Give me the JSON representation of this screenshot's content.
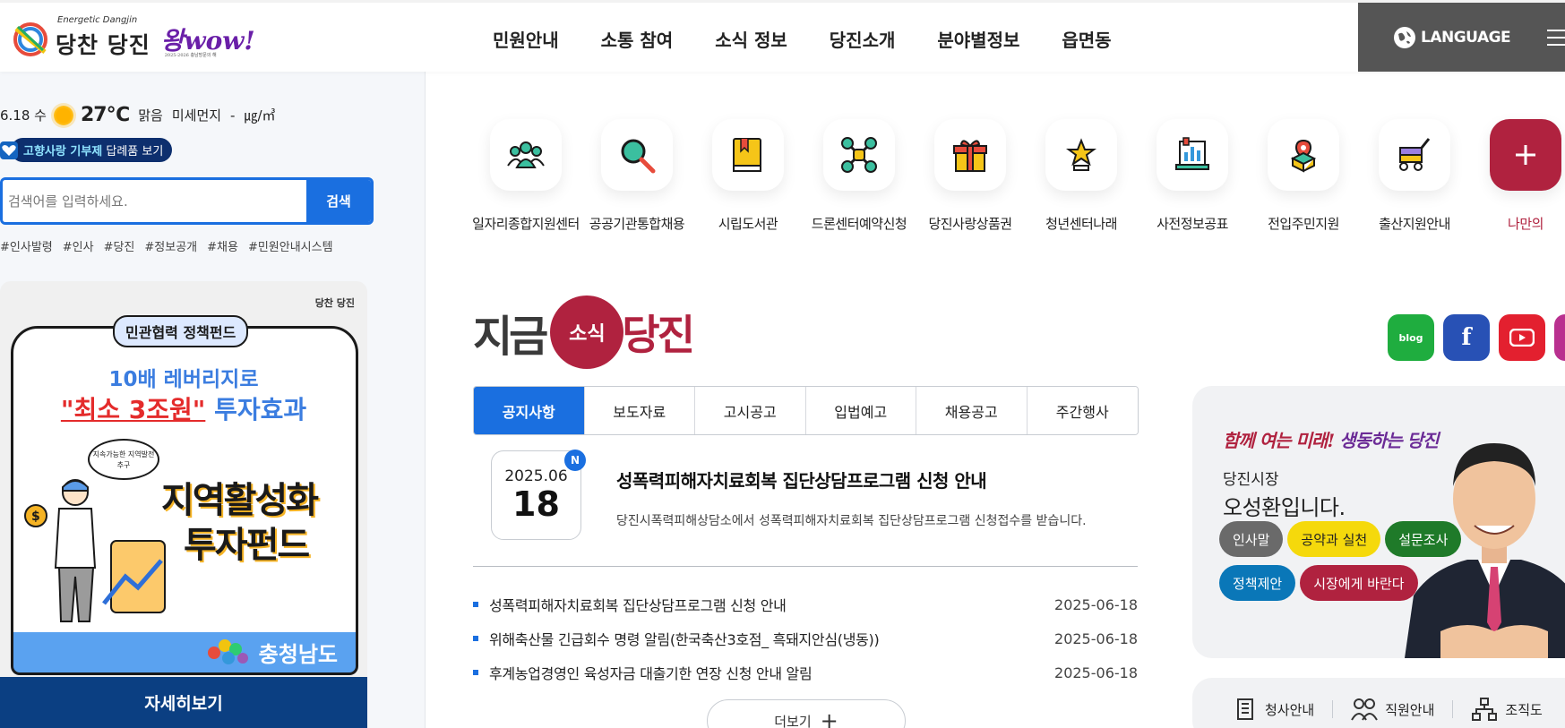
{
  "header": {
    "logo_tagline": "Energetic Dangjin",
    "logo_text": "당찬 당진",
    "wow_text": "왕wow!",
    "wow_sub": "2025-2026 충남방문의 해",
    "nav": [
      "민원안내",
      "소통 참여",
      "소식 정보",
      "당진소개",
      "분야별정보",
      "읍면동"
    ],
    "language_label": "LANGUAGE"
  },
  "weather": {
    "date": "6.18 수",
    "temperature": "27℃",
    "condition": "맑음",
    "dust_label": "미세먼지",
    "dust_value": "-",
    "dust_unit": "㎍/㎥"
  },
  "donation": {
    "highlight": "고향사랑 기부제",
    "rest": " 답례품 보기"
  },
  "search": {
    "placeholder": "검색어를 입력하세요.",
    "button": "검색"
  },
  "tags": [
    "#인사발령",
    "#인사",
    "#당진",
    "#정보공개",
    "#채용",
    "#민원안내시스템"
  ],
  "banner": {
    "logo_text": "당찬 당진",
    "tag": "민관협력 정책펀드",
    "line1": "10배 레버리지로",
    "line2_red": "\"최소 3조원\"",
    "line2_rest": " 투자효과",
    "bubble": "지속가능한 지역발전 추구",
    "big1": "지역활성화",
    "big2": "투자펀드",
    "province": "충청남도",
    "detail_button": "자세히보기"
  },
  "quick_links": [
    {
      "label": "일자리종합지원센터",
      "icon": "people-icon"
    },
    {
      "label": "공공기관통합채용",
      "icon": "search-icon"
    },
    {
      "label": "시립도서관",
      "icon": "book-icon"
    },
    {
      "label": "드론센터예약신청",
      "icon": "drone-icon"
    },
    {
      "label": "당진사랑상품권",
      "icon": "gift-icon"
    },
    {
      "label": "청년센터나래",
      "icon": "star-trophy-icon"
    },
    {
      "label": "사전정보공표",
      "icon": "chart-board-icon"
    },
    {
      "label": "전입주민지원",
      "icon": "location-box-icon"
    },
    {
      "label": "출산지원안내",
      "icon": "stroller-icon"
    },
    {
      "label": "나만의",
      "icon": "plus-icon"
    }
  ],
  "news": {
    "title_now": "지금",
    "title_circle": "소식",
    "title_dj": "당진",
    "tabs": [
      "공지사항",
      "보도자료",
      "고시공고",
      "입법예고",
      "채용공고",
      "주간행사"
    ],
    "featured": {
      "year_month": "2025.06",
      "day": "18",
      "badge": "N",
      "title": "성폭력피해자치료회복 집단상담프로그램 신청 안내",
      "desc": "당진시폭력피해상담소에서 성폭력피해자치료회복 집단상담프로그램 신청접수를 받습니다."
    },
    "items": [
      {
        "text": "성폭력피해자치료회복 집단상담프로그램 신청 안내",
        "date": "2025-06-18"
      },
      {
        "text": "위해축산물 긴급회수 명령 알림(한국축산3호점_ 흑돼지안심(냉동))",
        "date": "2025-06-18"
      },
      {
        "text": "후계농업경영인 육성자금 대출기한 연장 신청 안내 알림",
        "date": "2025-06-18"
      }
    ],
    "more_label": "더보기",
    "more_plus": "+"
  },
  "social": {
    "blog": "blog",
    "facebook": "f"
  },
  "mayor": {
    "slogan_a": "함께 여는 미래! ",
    "slogan_b": "생동하는 당진",
    "role": "당진시장",
    "name": "오성환입니다.",
    "pills_row1": [
      "인사말",
      "공약과 실천",
      "설문조사"
    ],
    "pills_row2": [
      "정책제안",
      "시장에게 바란다"
    ]
  },
  "util": [
    "청사안내",
    "직원안내",
    "조직도"
  ],
  "colors": {
    "primary_blue": "#1a6fe0",
    "brand_red": "#b0223f",
    "navy": "#0b3f82"
  }
}
